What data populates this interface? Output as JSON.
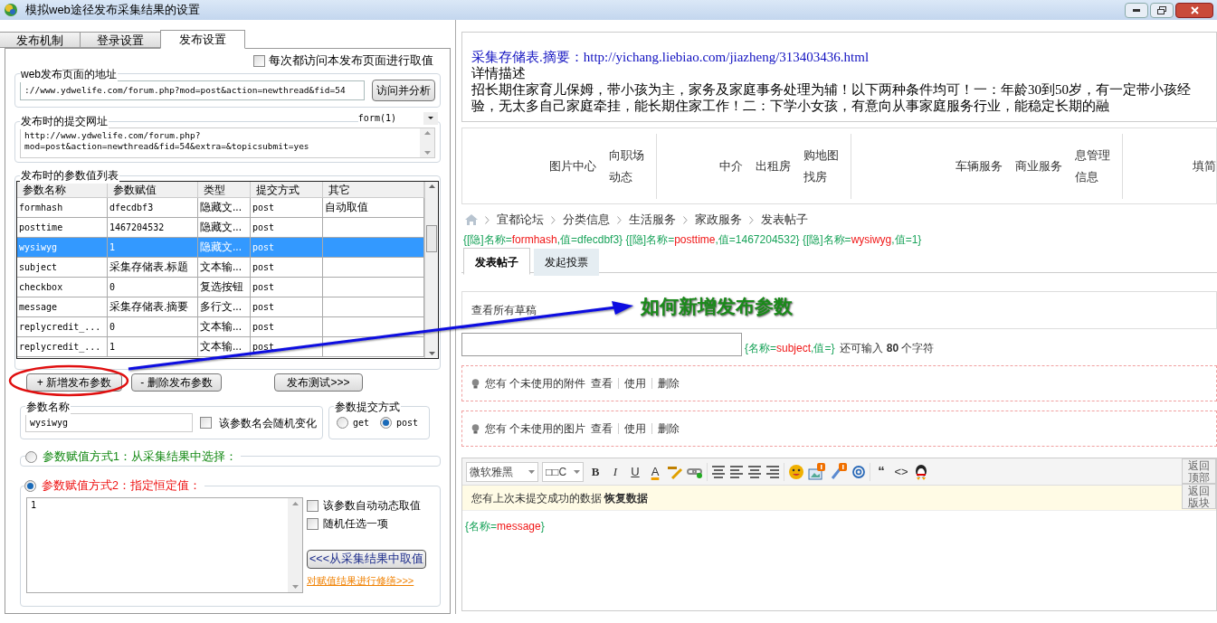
{
  "window": {
    "title": "模拟web途径发布采集结果的设置"
  },
  "tabs": [
    {
      "label": "发布机制",
      "selected": false
    },
    {
      "label": "登录设置",
      "selected": false
    },
    {
      "label": "发布设置",
      "selected": true
    }
  ],
  "always_fetch": {
    "label": "每次都访问本发布页面进行取值",
    "checked": false
  },
  "page_url": {
    "legend": "web发布页面的地址",
    "value": "://www.ydwelife.com/forum.php?mod=post&action=newthread&fid=54",
    "button": "访问并分析"
  },
  "submit_url": {
    "legend": "发布时的提交网址",
    "form_select": "form(1)",
    "value": "http://www.ydwelife.com/forum.php?\nmod=post&action=newthread&fid=54&extra=&topicsubmit=yes"
  },
  "params": {
    "legend": "发布时的参数值列表",
    "columns": [
      "参数名称",
      "参数赋值",
      "类型",
      "提交方式",
      "其它"
    ],
    "rows": [
      {
        "cells": [
          "formhash",
          "dfecdbf3",
          "隐藏文...",
          "post",
          "自动取值"
        ],
        "selected": false
      },
      {
        "cells": [
          "posttime",
          "1467204532",
          "隐藏文...",
          "post",
          ""
        ],
        "selected": false
      },
      {
        "cells": [
          "wysiwyg",
          "1",
          "隐藏文...",
          "post",
          ""
        ],
        "selected": true
      },
      {
        "cells": [
          "subject",
          "采集存储表.标题",
          "文本输...",
          "post",
          ""
        ],
        "selected": false
      },
      {
        "cells": [
          "checkbox",
          "0",
          "复选按钮",
          "post",
          ""
        ],
        "selected": false
      },
      {
        "cells": [
          "message",
          "采集存储表.摘要",
          "多行文...",
          "post",
          ""
        ],
        "selected": false
      },
      {
        "cells": [
          "replycredit_...",
          "0",
          "文本输...",
          "post",
          ""
        ],
        "selected": false
      },
      {
        "cells": [
          "replycredit_...",
          "1",
          "文本输...",
          "post",
          ""
        ],
        "selected": false
      }
    ]
  },
  "param_buttons": {
    "add": "+ 新增发布参数",
    "delete": "- 删除发布参数",
    "test": "发布测试>>>"
  },
  "param_name": {
    "legend": "参数名称",
    "value": "wysiwyg",
    "random": {
      "label": "该参数名会随机变化",
      "checked": false
    }
  },
  "submit_method": {
    "legend": "参数提交方式",
    "options": [
      {
        "label": "get",
        "selected": false
      },
      {
        "label": "post",
        "selected": true
      }
    ]
  },
  "assign_modes": [
    {
      "label": "参数赋值方式1：从采集结果中选择：",
      "selected": false
    },
    {
      "label": "参数赋值方式2：指定恒定值：",
      "selected": true
    }
  ],
  "constant": {
    "value": "1",
    "options": [
      {
        "label": "该参数自动动态取值",
        "checked": false
      },
      {
        "label": "随机任选一项",
        "checked": false
      }
    ],
    "fetch_button": "<<<从采集结果中取值",
    "fix_link": "对赋值结果进行修缮>>>"
  },
  "preview": {
    "summary_label": "采集存储表.摘要：",
    "summary_url": "http://yichang.liebiao.com/jiazheng/313403436.html",
    "heading": "详情描述",
    "body": "招长期住家育儿保姆，带小孩为主，家务及家庭事务处理为辅！以下两种条件均可！一：年龄30到50岁，有一定带小孩经验，无太多自己家庭牵挂，能长期住家工作！二：下学小女孩，有意向从事家庭服务行业，能稳定长期的融"
  },
  "nav_groups": [
    [
      "图片中心",
      "向职场动态"
    ],
    [
      "中介",
      "出租房",
      "购地图找房"
    ],
    [
      "车辆服务",
      "商业服务",
      "息管理信息"
    ],
    [
      "填简"
    ]
  ],
  "breadcrumb": [
    "宜都论坛",
    "分类信息",
    "生活服务",
    "家政服务",
    "发表帖子"
  ],
  "hidden_fields": [
    {
      "kind": "label",
      "text": "{[隐]名称="
    },
    {
      "kind": "name",
      "text": "formhash"
    },
    {
      "kind": "label",
      "text": ",值=dfecdbf3}"
    },
    {
      "kind": "label",
      "text": "{[隐]名称="
    },
    {
      "kind": "name",
      "text": "posttime"
    },
    {
      "kind": "label",
      "text": ",值=1467204532}"
    },
    {
      "kind": "label",
      "text": "{[隐]名称="
    },
    {
      "kind": "name",
      "text": "wysiwyg"
    },
    {
      "kind": "label",
      "text": ",值=1}"
    }
  ],
  "post_tabs": [
    {
      "label": "发表帖子",
      "selected": true
    },
    {
      "label": "发起投票",
      "selected": false
    }
  ],
  "drafts_link": "查看所有草稿",
  "subject_hint": [
    {
      "kind": "label",
      "text": "{名称="
    },
    {
      "kind": "name",
      "text": "subject"
    },
    {
      "kind": "label",
      "text": ",值=}"
    }
  ],
  "subject_counter": "还可输入 **80** 个字符",
  "notices": [
    {
      "text": "您有 个未使用的附件",
      "links": [
        "查看",
        "使用",
        "删除"
      ]
    },
    {
      "text": "您有 个未使用的图片",
      "links": [
        "查看",
        "使用",
        "删除"
      ]
    }
  ],
  "editor": {
    "font": "微软雅黑",
    "size": "□□C",
    "glyphs": [
      "B",
      "I",
      "U",
      "A"
    ],
    "quote": "“",
    "code": "<>",
    "restore": "您有上次未提交成功的数据 **恢复数据**",
    "message": [
      {
        "kind": "label",
        "text": "{名称="
      },
      {
        "kind": "name",
        "text": "message"
      },
      {
        "kind": "label",
        "text": "}"
      }
    ],
    "side_buttons": [
      "返回顶部",
      "返回版块"
    ]
  },
  "annotation": "如何新增发布参数"
}
